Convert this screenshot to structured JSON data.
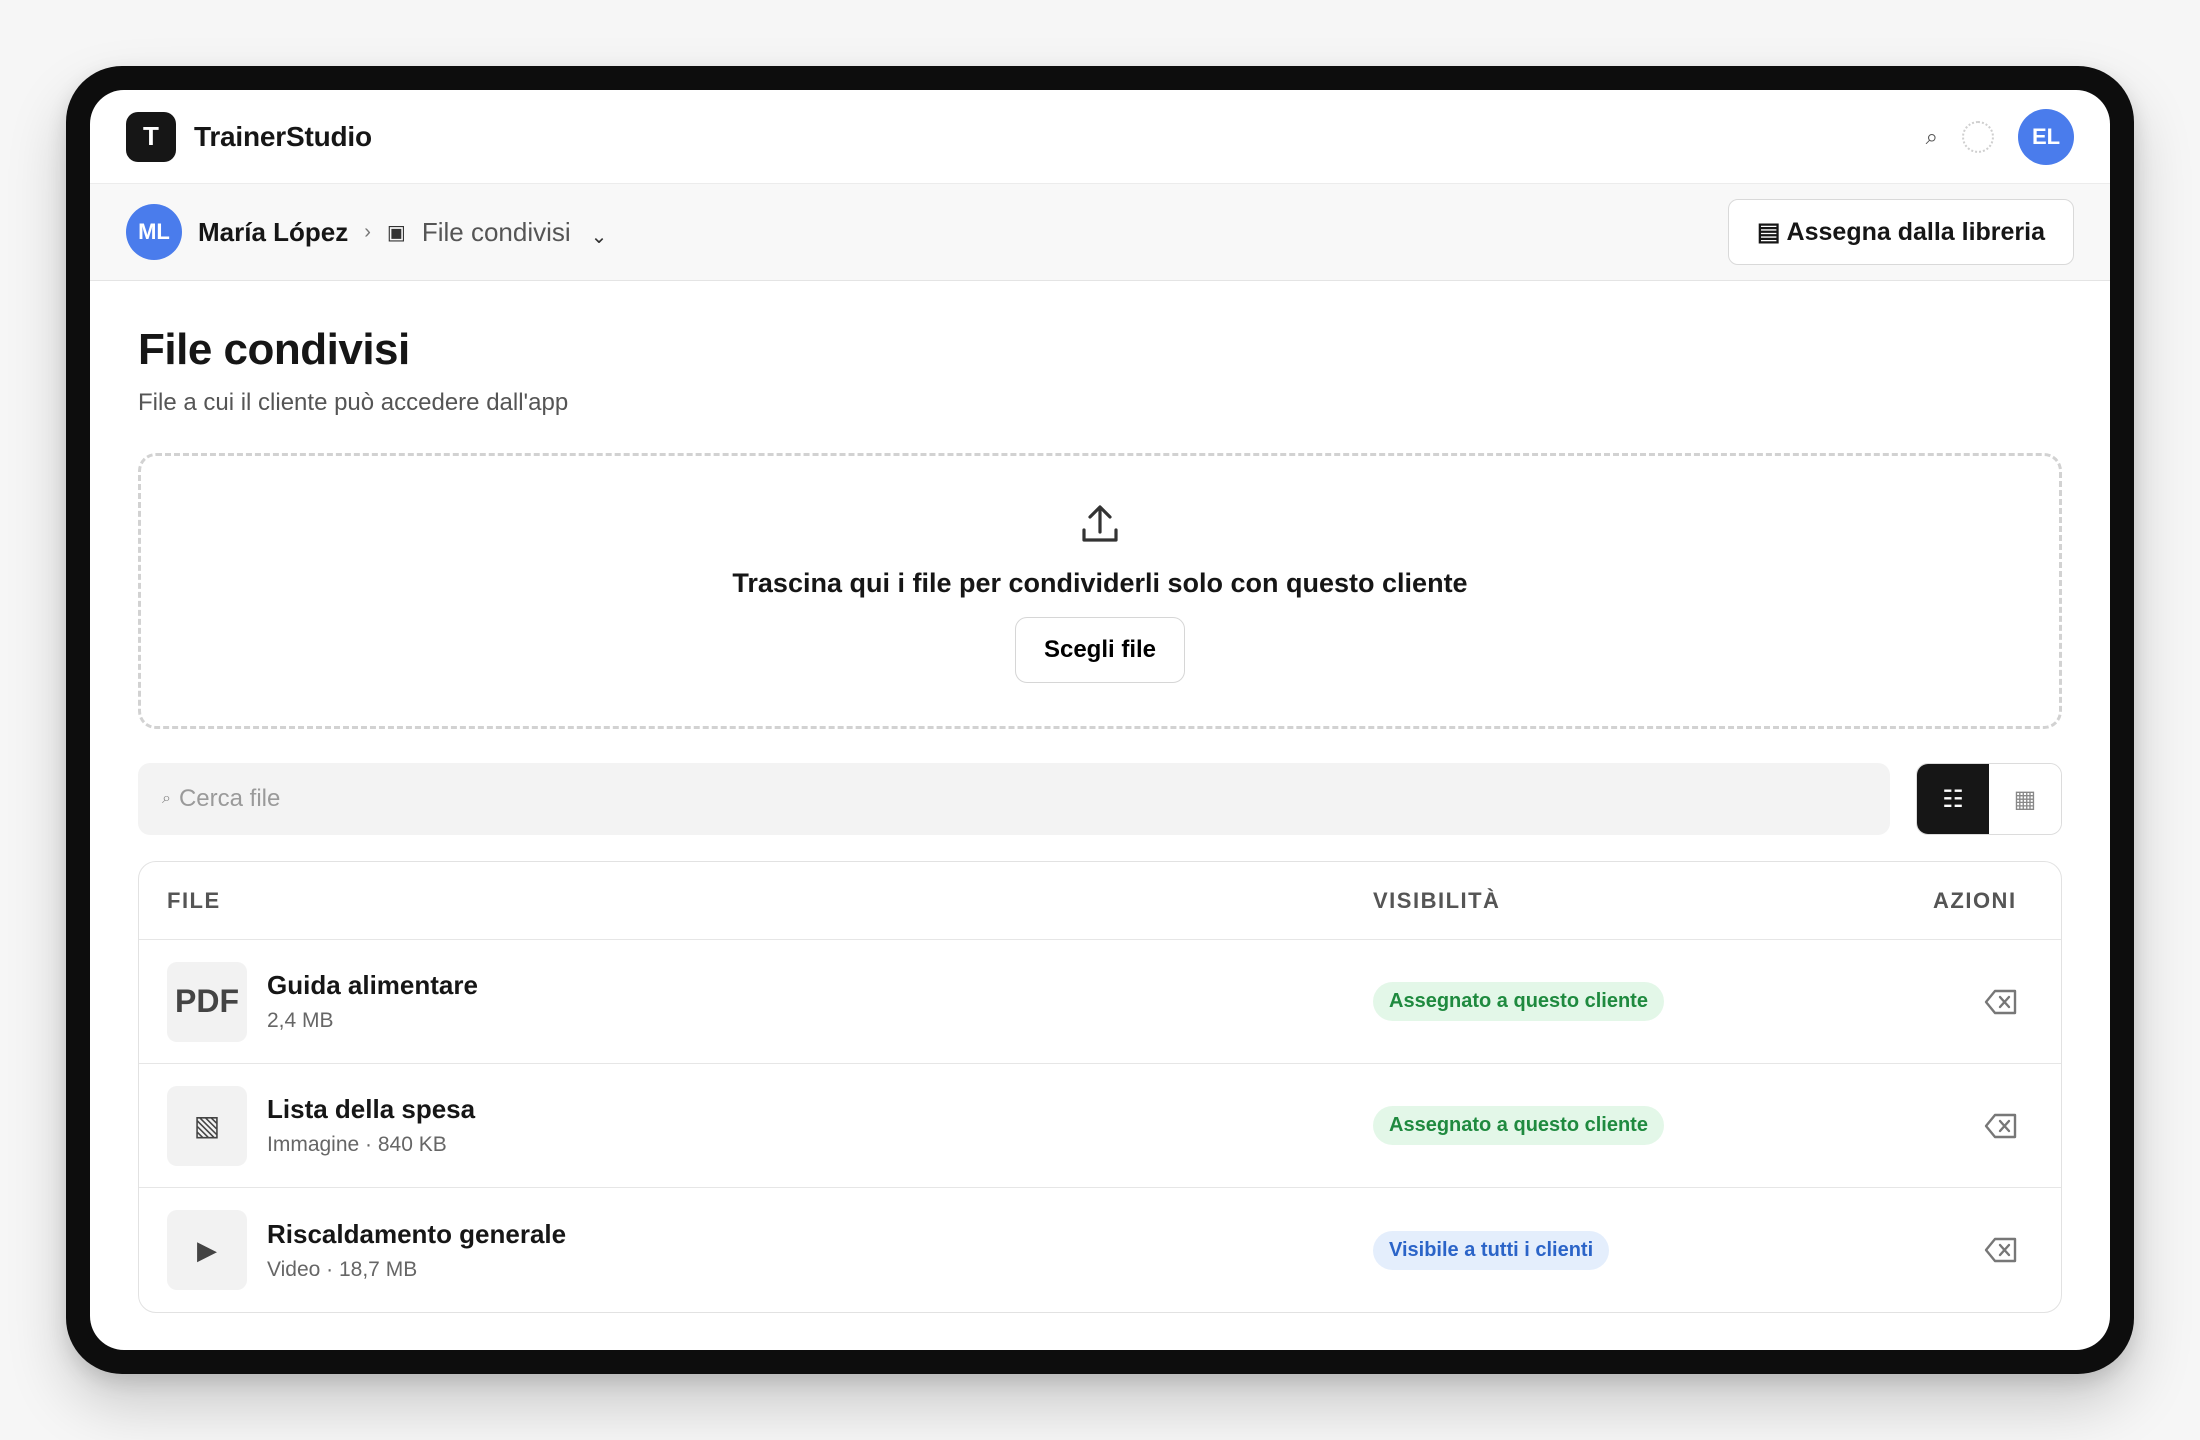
{
  "app": {
    "brand_initial": "T",
    "brand_name": "TrainerStudio",
    "search_icon": "⌕",
    "user_initials": "EL"
  },
  "breadcrumb": {
    "client_initials": "ML",
    "client_name": "María López",
    "separator": "›",
    "section_icon": "▣",
    "section": "File condivisi",
    "chevron": "⌄"
  },
  "actions": {
    "assign_icon": "▤",
    "assign_label": "Assegna dalla libreria"
  },
  "page": {
    "title": "File condivisi",
    "subtitle": "File a cui il cliente può accedere dall'app"
  },
  "dropzone": {
    "text": "Trascina qui i file per condividerli solo con questo cliente",
    "button": "Scegli file"
  },
  "search": {
    "icon": "⌕",
    "placeholder": "Cerca file",
    "value": ""
  },
  "view_toggle": {
    "list_icon": "☷",
    "grid_icon": "▦",
    "active": "list"
  },
  "table": {
    "headers": {
      "file": "FILE",
      "visibility": "VISIBILITÀ",
      "actions": "AZIONI"
    },
    "rows": [
      {
        "thumb": "PDF",
        "name": "Guida alimentare",
        "meta": "2,4 MB",
        "visibility": "Assegnato a questo cliente"
      },
      {
        "thumb": "▧",
        "name": "Lista della spesa",
        "meta": "Immagine · 840 KB",
        "visibility": "Assegnato a questo cliente"
      },
      {
        "thumb": "▶",
        "name": "Riscaldamento generale",
        "meta": "Video · 18,7 MB",
        "visibility": "Visibile a tutti i clienti"
      }
    ]
  },
  "colors": {
    "accent": "#161616",
    "avatar": "#4a7cec",
    "badge_green_bg": "#e3f7e8",
    "badge_green_text": "#1f8a3f",
    "badge_blue_bg": "#e4eefc",
    "badge_blue_text": "#2b64c8"
  }
}
